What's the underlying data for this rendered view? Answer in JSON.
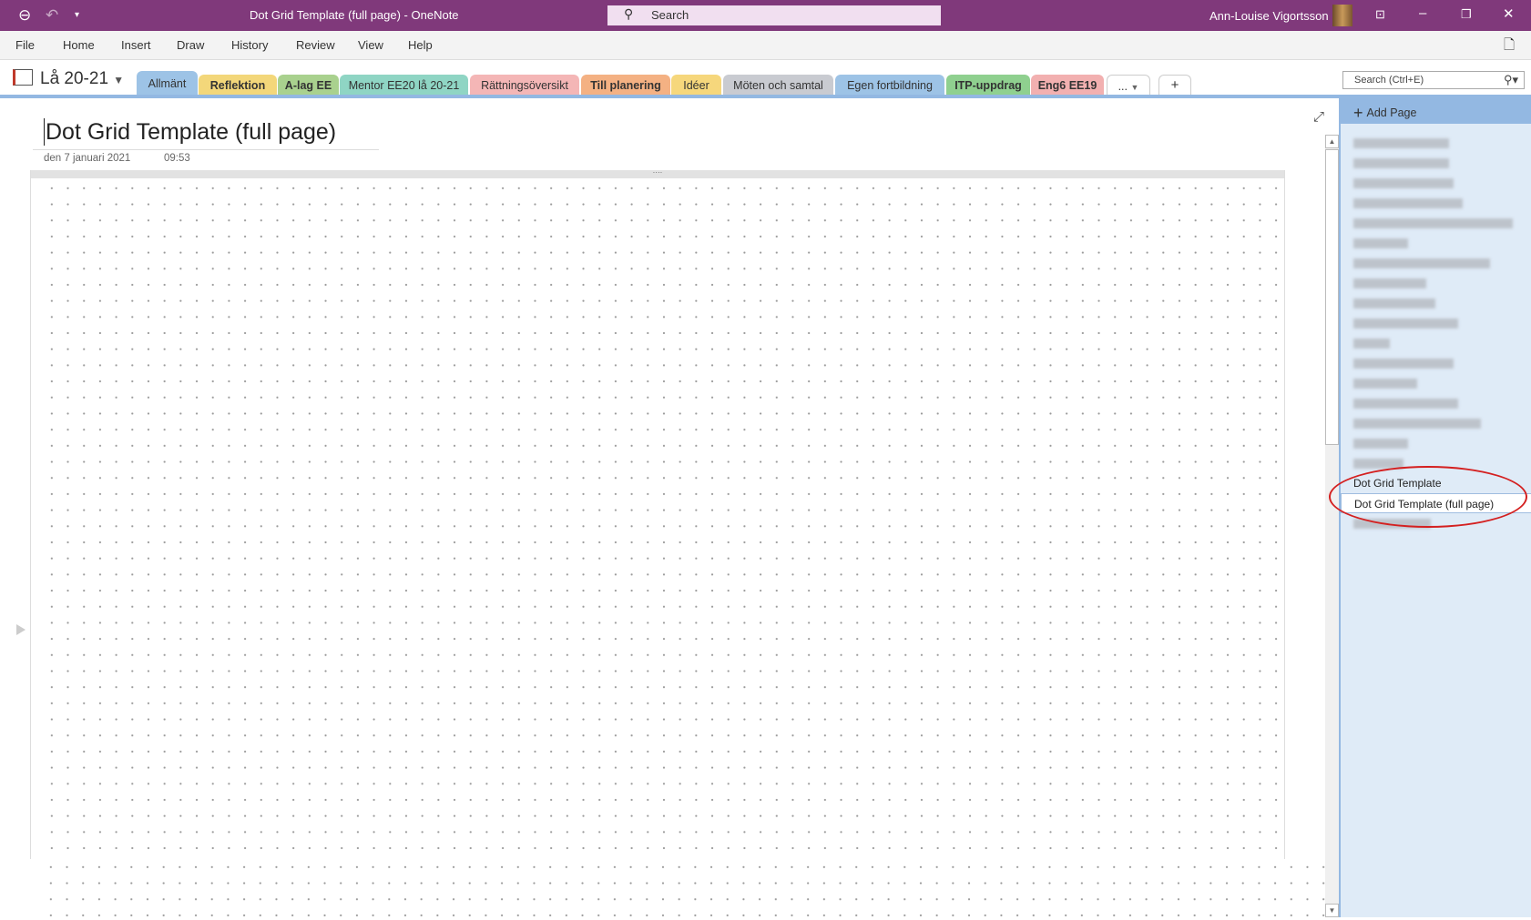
{
  "titlebar": {
    "window_title": "Dot Grid Template (full page)  -  OneNote",
    "search_placeholder": "Search",
    "user_name": "Ann-Louise Vigortsson",
    "icons": [
      "back-icon",
      "undo-icon",
      "customize-qat-icon",
      "search-icon",
      "ribbon-display-icon",
      "minimize-icon",
      "restore-icon",
      "close-icon"
    ]
  },
  "ribbon": {
    "menus": [
      "File",
      "Home",
      "Insert",
      "Draw",
      "History",
      "Review",
      "View",
      "Help"
    ]
  },
  "notebook": {
    "name": "Lå 20-21"
  },
  "sections": [
    {
      "label": "Allmänt",
      "color": "#9dc3e6",
      "bold": false,
      "selected": true
    },
    {
      "label": "Reflektion",
      "color": "#f3d77a",
      "bold": true
    },
    {
      "label": "A-lag EE",
      "color": "#a9d18e",
      "bold": true
    },
    {
      "label": "Mentor EE20 lå 20-21",
      "color": "#8fd5c4",
      "bold": false
    },
    {
      "label": "Rättningsöversikt",
      "color": "#f4b6b6",
      "bold": false
    },
    {
      "label": "Till planering",
      "color": "#f4b183",
      "bold": true
    },
    {
      "label": "Idéer",
      "color": "#f6d77c",
      "bold": false
    },
    {
      "label": "Möten och samtal",
      "color": "#c9cbd1",
      "bold": false
    },
    {
      "label": "Egen fortbildning",
      "color": "#9dc3e6",
      "bold": false
    },
    {
      "label": "ITP-uppdrag",
      "color": "#8fd08f",
      "bold": true
    },
    {
      "label": "Eng6 EE19",
      "color": "#f2b0b0",
      "bold": true
    }
  ],
  "section_more": "...",
  "section_add": "+",
  "page_search_placeholder": "Search (Ctrl+E)",
  "page": {
    "title": "Dot Grid Template (full page)",
    "date": "den 7 januari 2021",
    "time": "09:53"
  },
  "pagelist": {
    "add_page": "Add Page",
    "visible_pages": [
      "Dot Grid Template",
      "Dot Grid Template (full page)"
    ],
    "current": "Dot Grid Template (full page)"
  },
  "colors": {
    "accent": "#80397b",
    "highlight_circle": "#d42020",
    "pagelist_bg": "#dfebf7"
  }
}
